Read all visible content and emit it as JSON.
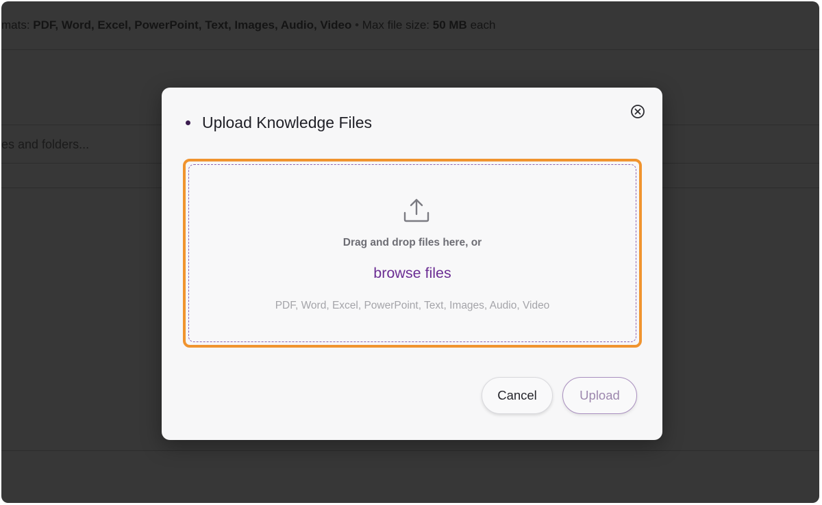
{
  "background": {
    "formats_prefix": "mats: ",
    "formats_bold": "PDF, Word, Excel, PowerPoint, Text, Images, Audio, Video",
    "separator": " • ",
    "max_size_label": "Max file size: ",
    "max_size_value": "50 MB",
    "max_size_suffix": " each",
    "search_placeholder": "es and folders..."
  },
  "modal": {
    "title": "Upload Knowledge Files",
    "close_icon": "close-circle-icon",
    "dropzone": {
      "icon": "upload-icon",
      "instruction": "Drag and drop files here, or",
      "browse_label": "browse files",
      "formats": "PDF, Word, Excel, PowerPoint, Text, Images, Audio, Video"
    },
    "cancel_label": "Cancel",
    "upload_label": "Upload"
  },
  "colors": {
    "overlay": "#373737",
    "accent": "#6b2d93",
    "highlight": "#f0942f"
  }
}
